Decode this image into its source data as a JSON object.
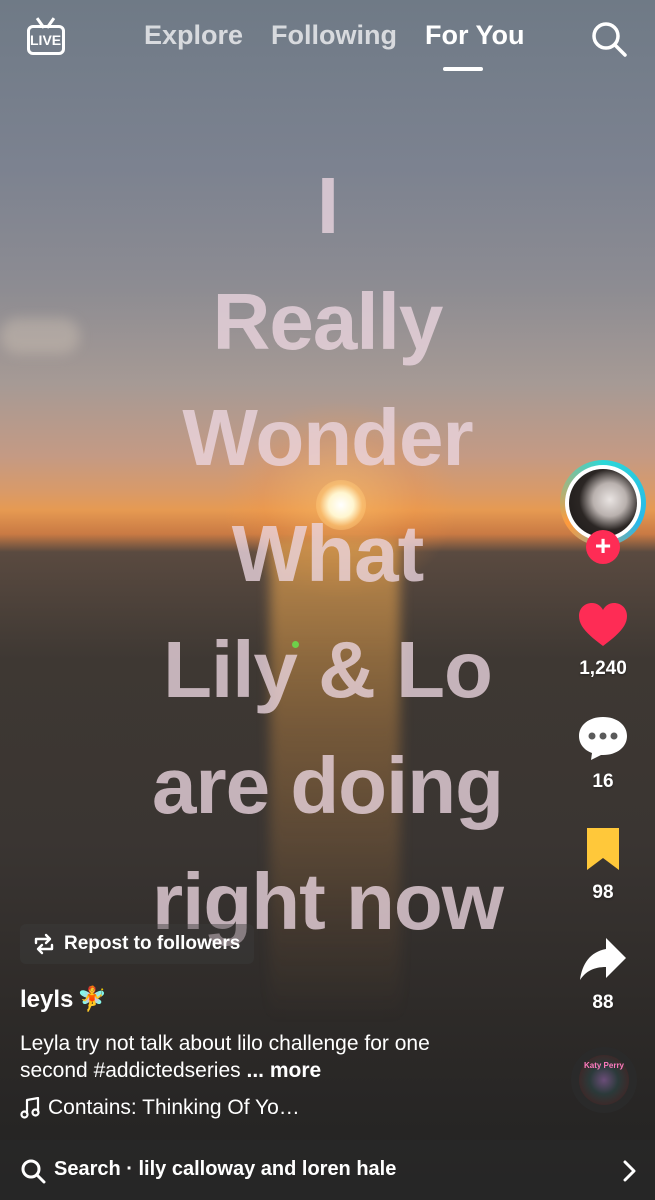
{
  "header": {
    "live_label": "LIVE",
    "tabs": [
      {
        "label": "Explore",
        "active": false
      },
      {
        "label": "Following",
        "active": false
      },
      {
        "label": "For You",
        "active": true
      }
    ]
  },
  "video": {
    "overlay_lines": [
      "I",
      "Really",
      "Wonder",
      "What",
      "Lily & Lo",
      "are doing",
      "right now"
    ]
  },
  "rail": {
    "likes": "1,240",
    "comments": "16",
    "saves": "98",
    "shares": "88",
    "accent": "#fe2c55",
    "save_color": "#ffc83a"
  },
  "post": {
    "repost_label": "Repost to followers",
    "username": "leyls",
    "username_emoji": "🧚",
    "caption_text": "Leyla try not talk about lilo challenge for one second ",
    "hashtag": "#addictedseries",
    "caption_more": " ... more",
    "sound_label": "Contains: Thinking Of Yo…",
    "disc_label": "Katy Perry"
  },
  "search": {
    "label": "Search · lily calloway and loren hale"
  }
}
